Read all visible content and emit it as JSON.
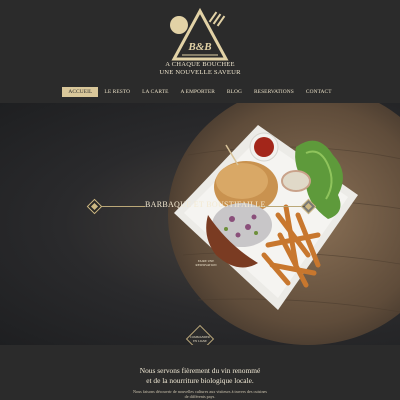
{
  "brand": {
    "logo_text": "B&B",
    "tagline_line1": "A CHAQUE BOUCHEE",
    "tagline_line2": "UNE NOUVELLE SAVEUR"
  },
  "nav": {
    "items": [
      {
        "label": "ACCUEIL",
        "active": true
      },
      {
        "label": "LE RESTO",
        "active": false
      },
      {
        "label": "LA CARTE",
        "active": false
      },
      {
        "label": "A EMPORTER",
        "active": false
      },
      {
        "label": "BLOG",
        "active": false
      },
      {
        "label": "RESERVATIONS",
        "active": false
      },
      {
        "label": "CONTACT",
        "active": false
      }
    ]
  },
  "hero": {
    "title": "BARBAQUE ET BOUSTIFAILLE",
    "caption_line1": "FAIRE UNE",
    "caption_line2": "RESERVATION"
  },
  "order_badge": {
    "line1": "COMMANDER",
    "line2": "EN LIGNE"
  },
  "intro": {
    "heading_line1": "Nous servons fièrement du vin renommé",
    "heading_line2": "et de la nourriture biologique locale.",
    "sub_line1": "Nous faisons découvrir de nouvelles cultures aux visiteurs à travers des cuisines",
    "sub_line2": "de différents pays."
  },
  "colors": {
    "background": "#2b2b2b",
    "accent_gold": "#d9c79a",
    "text_cream": "#efe6cf"
  }
}
